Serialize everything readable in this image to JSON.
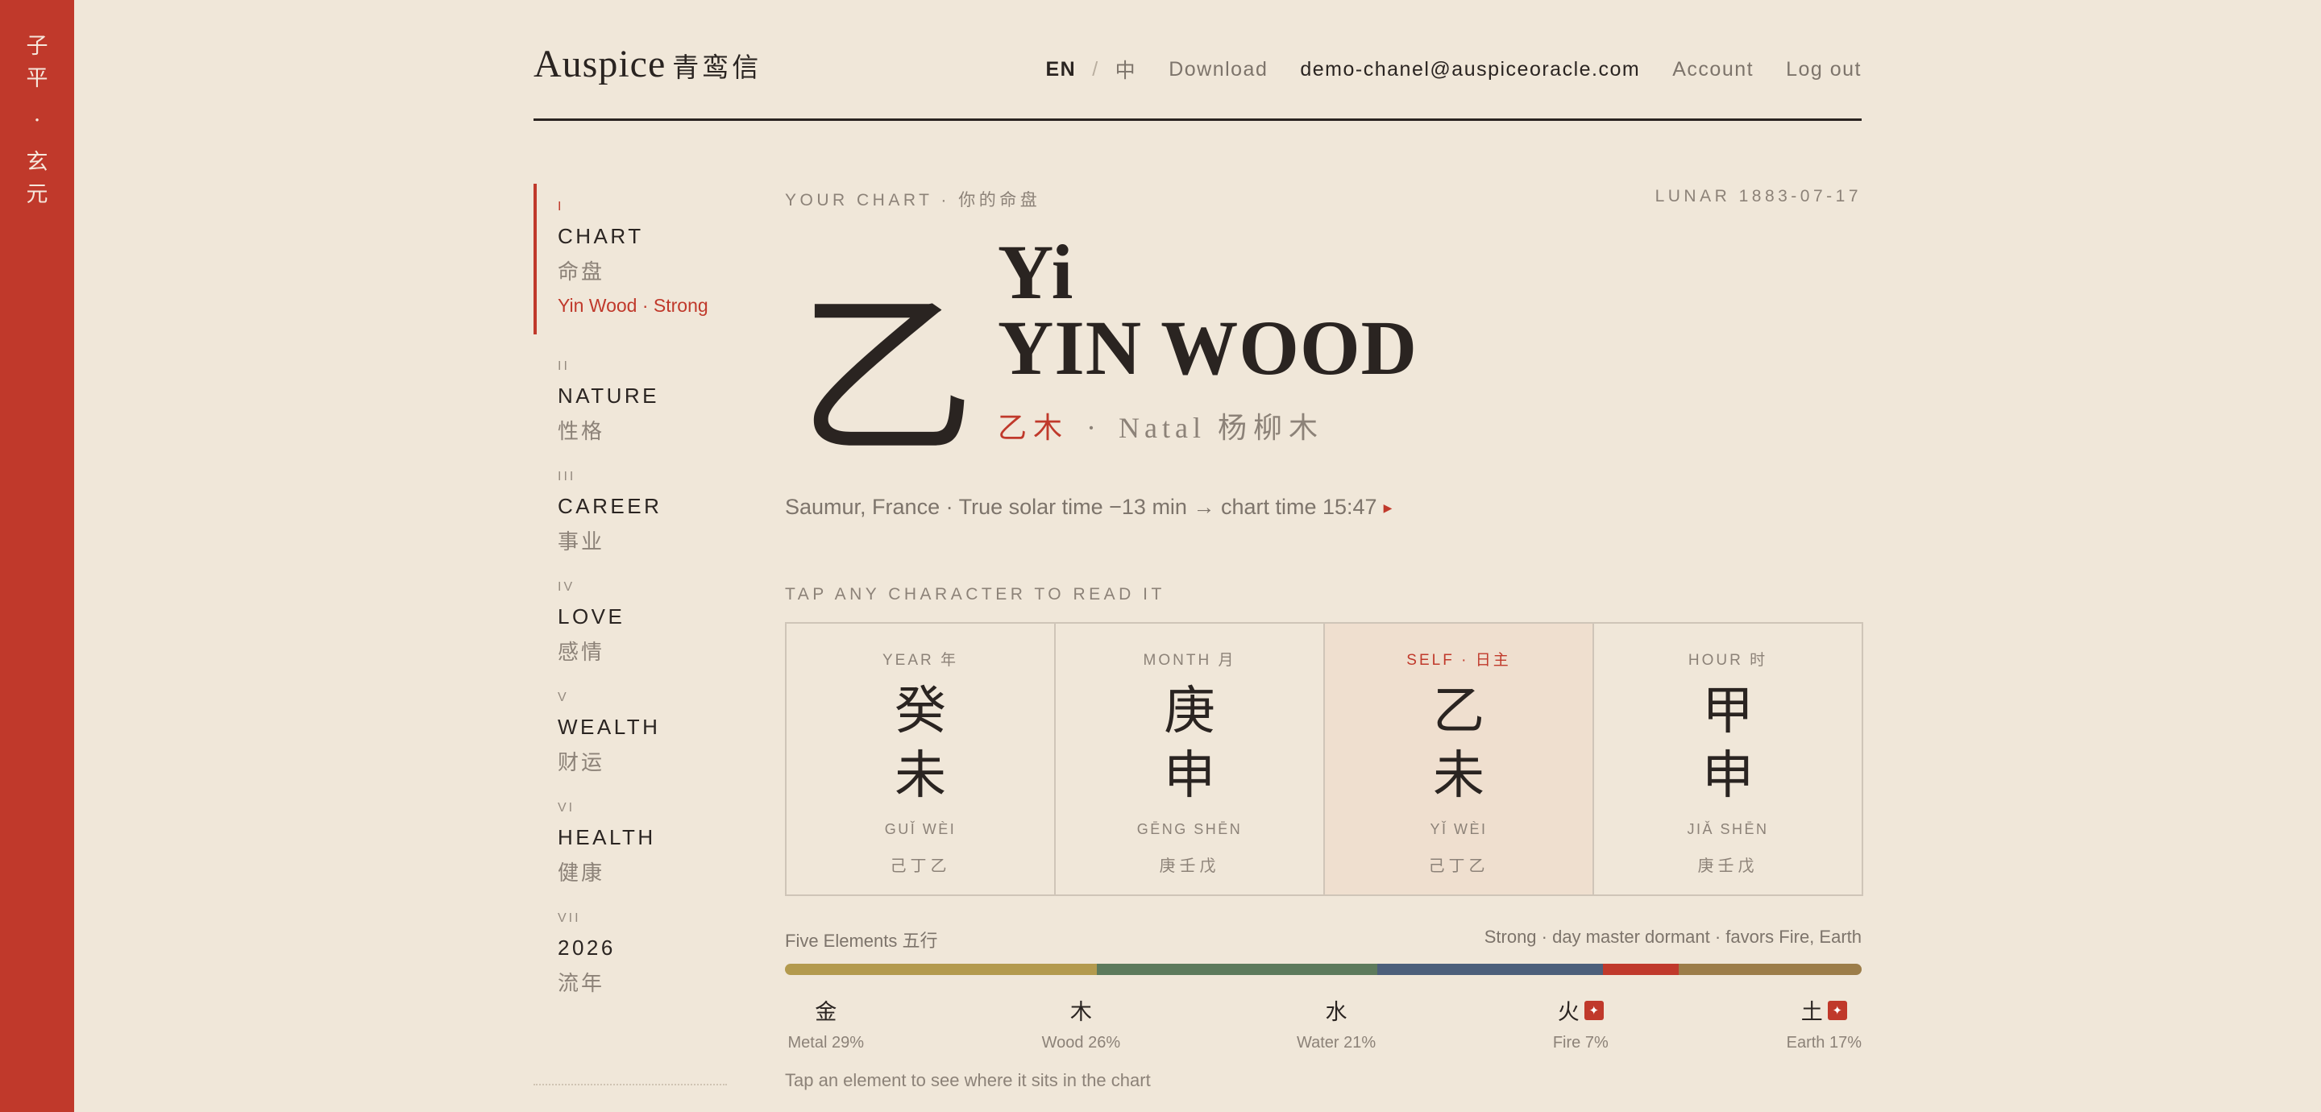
{
  "rail": {
    "chars": [
      "子",
      "平",
      "·",
      "玄",
      "元"
    ]
  },
  "header": {
    "logo_en": "Auspice",
    "logo_cn": "青鸾信",
    "lang_en": "EN",
    "lang_sep": "/",
    "lang_zh": "中",
    "download": "Download",
    "email": "demo-chanel@auspiceoracle.com",
    "account": "Account",
    "logout": "Log out"
  },
  "sidebar": {
    "items": [
      {
        "num": "I",
        "en": "CHART",
        "cn": "命盘",
        "sub": "Yin Wood · Strong"
      },
      {
        "num": "II",
        "en": "NATURE",
        "cn": "性格"
      },
      {
        "num": "III",
        "en": "CAREER",
        "cn": "事业"
      },
      {
        "num": "IV",
        "en": "LOVE",
        "cn": "感情"
      },
      {
        "num": "V",
        "en": "WEALTH",
        "cn": "财运"
      },
      {
        "num": "VI",
        "en": "HEALTH",
        "cn": "健康"
      },
      {
        "num": "VII",
        "en": "2026",
        "cn": "流年"
      }
    ]
  },
  "main": {
    "your_chart": "YOUR CHART · 你的命盘",
    "lunar": "LUNAR 1883-07-17",
    "big_glyph": "乙",
    "title_pinyin": "Yi",
    "title_element": "YIN WOOD",
    "title_stem": "乙木",
    "title_dot": "·",
    "title_natal": "Natal",
    "title_natal_cn": "杨柳木",
    "location": "Saumur, France · True solar time −13 min → chart time 15:47",
    "tap_label": "TAP ANY CHARACTER TO READ IT"
  },
  "pillars": [
    {
      "head": "YEAR 年",
      "stem": "癸",
      "branch": "未",
      "pinyin": "GUǏ WÈI",
      "hidden": "己丁乙"
    },
    {
      "head": "MONTH 月",
      "stem": "庚",
      "branch": "申",
      "pinyin": "GĒNG SHĒN",
      "hidden": "庚壬戊"
    },
    {
      "head": "SELF · 日主",
      "stem": "乙",
      "branch": "未",
      "pinyin": "YǏ WÈI",
      "hidden": "己丁乙"
    },
    {
      "head": "HOUR 时",
      "stem": "甲",
      "branch": "申",
      "pinyin": "JIǍ SHĒN",
      "hidden": "庚壬戊"
    }
  ],
  "elements": {
    "title": "Five Elements 五行",
    "summary": "Strong · day master dormant · favors Fire, Earth",
    "items": [
      {
        "glyph": "金",
        "label": "Metal 29%",
        "percent": 29,
        "color": "#b39a4e",
        "favored": false
      },
      {
        "glyph": "木",
        "label": "Wood 26%",
        "percent": 26,
        "color": "#5d7a5c",
        "favored": false
      },
      {
        "glyph": "水",
        "label": "Water 21%",
        "percent": 21,
        "color": "#4c5f7a",
        "favored": false
      },
      {
        "glyph": "火",
        "label": "Fire 7%",
        "percent": 7,
        "color": "#c0392b",
        "favored": true
      },
      {
        "glyph": "土",
        "label": "Earth 17%",
        "percent": 17,
        "color": "#9c7d49",
        "favored": true
      }
    ],
    "badge_icon": "✦",
    "hint": "Tap an element to see where it sits in the chart"
  },
  "colors": {
    "accent": "#c0392b",
    "background": "#f0e7d9",
    "ink": "#2a2421",
    "self_pillar_bg": "#efdfcf"
  }
}
